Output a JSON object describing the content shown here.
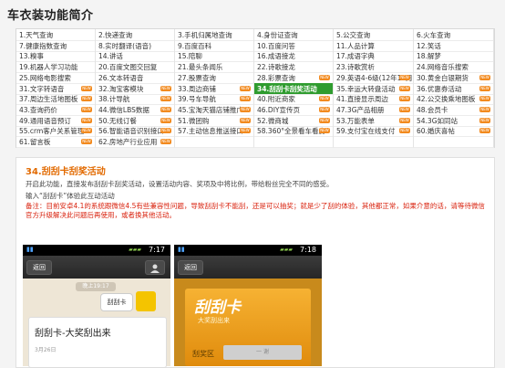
{
  "page": {
    "title": "车衣装功能简介"
  },
  "features": {
    "rows": [
      [
        "1.天气查询",
        "2.快递查询",
        "3.手机归属地查询",
        "4.身份证查询",
        "5.公交查询",
        "6.火车查询"
      ],
      [
        "7.健康指数查询",
        "8.实时翻译(语音)",
        "9.百度百科",
        "10.百度问答",
        "11.人品计算",
        "12.笑话"
      ],
      [
        "13.糗事",
        "14.讲话",
        "15.陪聊",
        "16.成语接龙",
        "17.成语字典",
        "18.解梦"
      ],
      [
        "19.机器人学习功能",
        "20.百度文图交回复",
        "21.最头条闻乐",
        "22.诗歌接龙",
        "23.诗歌赏析",
        "24.网络音乐搜索"
      ],
      [
        "25.网络电影搜索",
        "26.文本转语音",
        "27.股票查询",
        "28.彩票查询",
        "29.英语4-6级(12年12月)",
        "30.黄金白银期货"
      ],
      [
        "31.文字转语音",
        "32.淘宝客模块",
        "33.周边商铺",
        "34.刮刮卡刮奖活动",
        "35.幸运大转盘活动",
        "36.优惠券活动"
      ],
      [
        "37.周边生活地图板",
        "38.计导航",
        "39.号车导航",
        "40.附近商家",
        "41.直接显示周边",
        "42.公交换乘地图板"
      ],
      [
        "43.查询药价",
        "44.微信LBS数据",
        "45.宝淘天猫店铺推广",
        "46.DIY宣传页",
        "47.3G产品相册",
        "48.会员卡"
      ],
      [
        "49.通用语音预订",
        "50.无线订餐",
        "51.微团购",
        "52.微商城",
        "53.万能表单",
        "54.3G如同站"
      ],
      [
        "55.crm客户关系管理",
        "56.智能语音识别接口",
        "57.主动信息推送接口",
        "58.360°全景看车看房",
        "59.支付宝在线支付",
        "60.婚庆喜帖"
      ],
      [
        "61.留言板",
        "62.房地产行业应用",
        "",
        "",
        "",
        ""
      ]
    ],
    "active_index": "34.刮刮卡刮奖活动",
    "new_badge_text": "NEW"
  },
  "section": {
    "title": "34.刮刮卡刮奖活动",
    "desc1": "开启此功能，直接发布刮刮卡刮奖活动，设置活动内容、奖项及中将比例，带给粉丝完全不同的感受。",
    "desc2": "输入“刮刮卡”体验此互动活动",
    "note": "备注：目前安卓4.1的系统跟微信4.5有些兼容性问题，导致刮刮卡不能刮，还是可以抽奖；就是少了刮的体验，其他都正常，如果介意的话，请等待微信官方升级解决此问题后再使用，或者换其他活动。"
  },
  "phone_left": {
    "time": "7:17",
    "back": "返回",
    "time_chip": "晚上19:17",
    "bubble": "刮刮卡",
    "card_title": "刮刮卡-大奖刮出来",
    "card_date": "3月26日"
  },
  "phone_right": {
    "time": "7:18",
    "back": "返回",
    "card_big": "刮刮卡",
    "card_sub": "大奖刮出来",
    "label": "刮奖区",
    "area": "一 谢"
  }
}
